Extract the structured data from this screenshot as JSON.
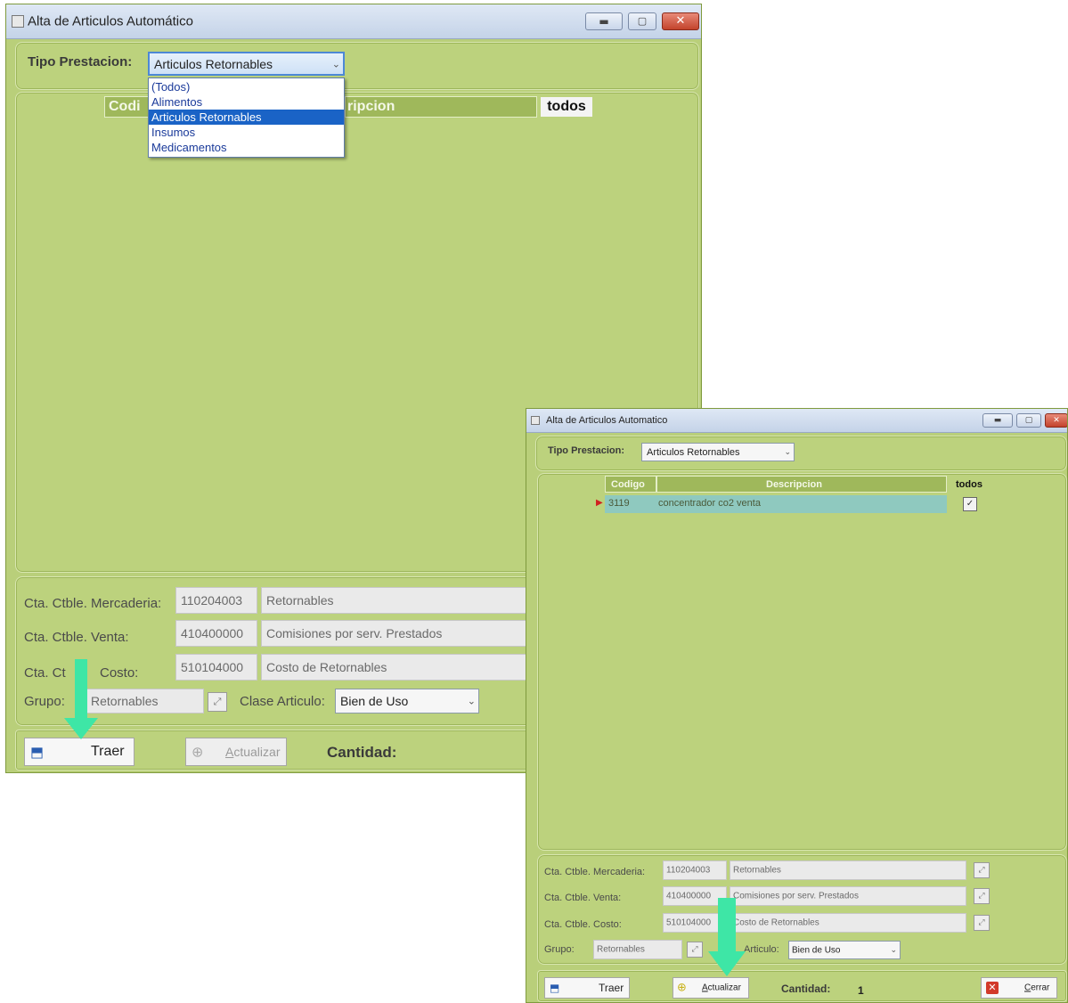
{
  "window_main": {
    "title": "Alta de Articulos Automático",
    "tipo_label": "Tipo Prestacion:",
    "tipo_value": "Articulos Retornables",
    "dropdown_options": [
      "(Todos)",
      "Alimentos",
      "Articulos Retornables",
      "Insumos",
      "Medicamentos"
    ],
    "dropdown_selected": "Articulos Retornables",
    "grid_codigo_partial": "Codi",
    "grid_descripcion_partial": "ripcion",
    "grid_todos": "todos",
    "fields": {
      "mercaderia_label": "Cta. Ctble. Mercaderia:",
      "mercaderia_code": "110204003",
      "mercaderia_desc": "Retornables",
      "venta_label": "Cta. Ctble. Venta:",
      "venta_code": "410400000",
      "venta_desc": "Comisiones por serv. Prestados",
      "costo_label_a": "Cta. Ct",
      "costo_label_b": "Costo:",
      "costo_code": "510104000",
      "costo_desc": "Costo de Retornables",
      "grupo_label": "Grupo:",
      "grupo_value": "Retornables",
      "clase_label": "Clase Articulo:",
      "clase_value": "Bien de Uso"
    },
    "buttons": {
      "traer": "Traer",
      "actualizar_first": "A",
      "actualizar_rest": "ctualizar",
      "cantidad_label": "Cantidad:"
    }
  },
  "window_second": {
    "title": "Alta de Articulos Automatico",
    "tipo_label": "Tipo Prestacion:",
    "tipo_value": "Articulos Retornables",
    "grid": {
      "col_codigo": "Codigo",
      "col_descripcion": "Descripcion",
      "col_todos": "todos",
      "rows": [
        {
          "codigo": "3119",
          "descripcion": "concentrador co2 venta"
        }
      ]
    },
    "fields": {
      "mercaderia_label": "Cta. Ctble. Mercaderia:",
      "mercaderia_code": "110204003",
      "mercaderia_desc": "Retornables",
      "venta_label": "Cta. Ctble. Venta:",
      "venta_code": "410400000",
      "venta_desc": "Comisiones por serv. Prestados",
      "costo_label": "Cta. Ctble. Costo:",
      "costo_code": "510104000",
      "costo_desc": "Costo de Retornables",
      "grupo_label": "Grupo:",
      "grupo_value": "Retornables",
      "clase_label_partial": "Articulo:",
      "clase_value": "Bien de Uso"
    },
    "buttons": {
      "traer": "Traer",
      "actualizar_first": "A",
      "actualizar_rest": "ctualizar",
      "cantidad_label": "Cantidad:",
      "cantidad_value": "1",
      "cerrar_first": "C",
      "cerrar_rest": "errar"
    }
  },
  "colors": {
    "window_bg": "#b9cf7a",
    "grid_header": "#9fb85b",
    "row_highlight": "#8fc9bf",
    "annotation_arrow": "#3ee6a6",
    "selected_option": "#1a63c6"
  },
  "icons": [
    "app-window-icon",
    "minimize-icon",
    "maximize-icon",
    "close-icon",
    "dropdown-arrow-icon",
    "lookup-icon",
    "traer-icon",
    "actualizar-icon",
    "cerrar-icon",
    "row-pointer-icon",
    "select-all-icon"
  ]
}
